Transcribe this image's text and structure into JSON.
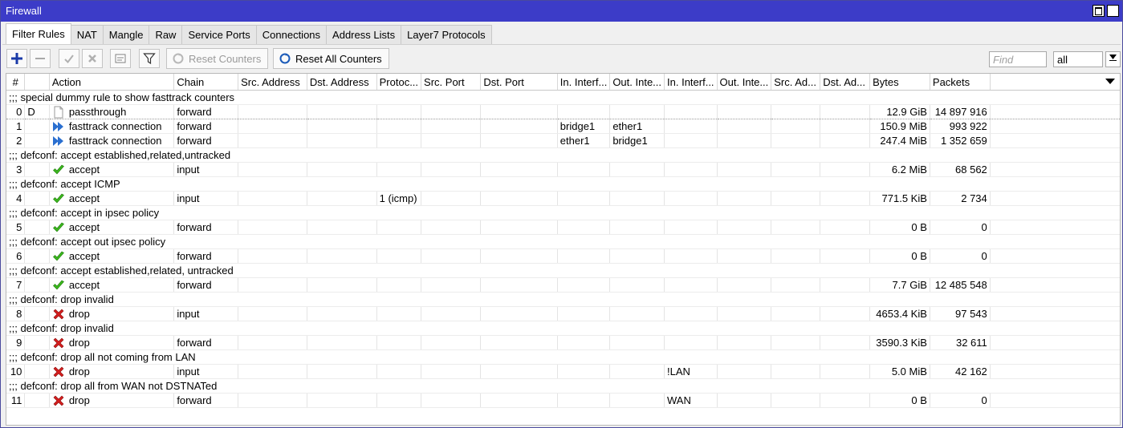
{
  "window": {
    "title": "Firewall"
  },
  "tabs": [
    {
      "label": "Filter Rules",
      "active": true
    },
    {
      "label": "NAT"
    },
    {
      "label": "Mangle"
    },
    {
      "label": "Raw"
    },
    {
      "label": "Service Ports"
    },
    {
      "label": "Connections"
    },
    {
      "label": "Address Lists"
    },
    {
      "label": "Layer7 Protocols"
    }
  ],
  "toolbar": {
    "add_icon": "plus-icon",
    "remove_icon": "minus-icon",
    "enable_icon": "check-icon",
    "disable_icon": "x-icon",
    "comment_icon": "note-icon",
    "filter_icon": "filter-icon",
    "reset_counters": "Reset Counters",
    "reset_all_counters": "Reset All Counters",
    "find_placeholder": "Find",
    "filter_select": "all"
  },
  "columns": [
    "#",
    "",
    "Action",
    "Chain",
    "Src. Address",
    "Dst. Address",
    "Protoc...",
    "Src. Port",
    "Dst. Port",
    "In. Interf...",
    "Out. Inte...",
    "In. Interf...",
    "Out. Inte...",
    "Src. Ad...",
    "Dst. Ad...",
    "Bytes",
    "Packets"
  ],
  "rows": [
    {
      "type": "comment",
      "text": ";;; special dummy rule to show fasttrack counters"
    },
    {
      "type": "rule",
      "num": "0",
      "flag": "D",
      "action": "passthrough",
      "icon": "passthrough",
      "chain": "forward",
      "proto": "",
      "in_if": "",
      "out_if": "",
      "in_list": "",
      "bytes": "12.9 GiB",
      "packets": "14 897 916"
    },
    {
      "type": "rule",
      "num": "1",
      "flag": "",
      "action": "fasttrack connection",
      "icon": "fasttrack",
      "chain": "forward",
      "proto": "",
      "in_if": "bridge1",
      "out_if": "ether1",
      "in_list": "",
      "bytes": "150.9 MiB",
      "packets": "993 922"
    },
    {
      "type": "rule",
      "num": "2",
      "flag": "",
      "action": "fasttrack connection",
      "icon": "fasttrack",
      "chain": "forward",
      "proto": "",
      "in_if": "ether1",
      "out_if": "bridge1",
      "in_list": "",
      "bytes": "247.4 MiB",
      "packets": "1 352 659"
    },
    {
      "type": "comment",
      "text": ";;; defconf: accept established,related,untracked"
    },
    {
      "type": "rule",
      "num": "3",
      "flag": "",
      "action": "accept",
      "icon": "accept",
      "chain": "input",
      "proto": "",
      "in_if": "",
      "out_if": "",
      "in_list": "",
      "bytes": "6.2 MiB",
      "packets": "68 562"
    },
    {
      "type": "comment",
      "text": ";;; defconf: accept ICMP"
    },
    {
      "type": "rule",
      "num": "4",
      "flag": "",
      "action": "accept",
      "icon": "accept",
      "chain": "input",
      "proto": "1 (icmp)",
      "in_if": "",
      "out_if": "",
      "in_list": "",
      "bytes": "771.5 KiB",
      "packets": "2 734"
    },
    {
      "type": "comment",
      "text": ";;; defconf: accept in ipsec policy"
    },
    {
      "type": "rule",
      "num": "5",
      "flag": "",
      "action": "accept",
      "icon": "accept",
      "chain": "forward",
      "proto": "",
      "in_if": "",
      "out_if": "",
      "in_list": "",
      "bytes": "0 B",
      "packets": "0"
    },
    {
      "type": "comment",
      "text": ";;; defconf: accept out ipsec policy"
    },
    {
      "type": "rule",
      "num": "6",
      "flag": "",
      "action": "accept",
      "icon": "accept",
      "chain": "forward",
      "proto": "",
      "in_if": "",
      "out_if": "",
      "in_list": "",
      "bytes": "0 B",
      "packets": "0"
    },
    {
      "type": "comment",
      "text": ";;; defconf: accept established,related, untracked"
    },
    {
      "type": "rule",
      "num": "7",
      "flag": "",
      "action": "accept",
      "icon": "accept",
      "chain": "forward",
      "proto": "",
      "in_if": "",
      "out_if": "",
      "in_list": "",
      "bytes": "7.7 GiB",
      "packets": "12 485 548"
    },
    {
      "type": "comment",
      "text": ";;; defconf: drop invalid"
    },
    {
      "type": "rule",
      "num": "8",
      "flag": "",
      "action": "drop",
      "icon": "drop",
      "chain": "input",
      "proto": "",
      "in_if": "",
      "out_if": "",
      "in_list": "",
      "bytes": "4653.4 KiB",
      "packets": "97 543"
    },
    {
      "type": "comment",
      "text": ";;; defconf: drop invalid"
    },
    {
      "type": "rule",
      "num": "9",
      "flag": "",
      "action": "drop",
      "icon": "drop",
      "chain": "forward",
      "proto": "",
      "in_if": "",
      "out_if": "",
      "in_list": "",
      "bytes": "3590.3 KiB",
      "packets": "32 611"
    },
    {
      "type": "comment",
      "text": ";;; defconf: drop all not coming from LAN"
    },
    {
      "type": "rule",
      "num": "10",
      "flag": "",
      "action": "drop",
      "icon": "drop",
      "chain": "input",
      "proto": "",
      "in_if": "",
      "out_if": "",
      "in_list": "!LAN",
      "bytes": "5.0 MiB",
      "packets": "42 162"
    },
    {
      "type": "comment",
      "text": ";;; defconf:  drop all from WAN not DSTNATed"
    },
    {
      "type": "rule",
      "num": "11",
      "flag": "",
      "action": "drop",
      "icon": "drop",
      "chain": "forward",
      "proto": "",
      "in_if": "",
      "out_if": "",
      "in_list": "WAN",
      "bytes": "0 B",
      "packets": "0"
    }
  ],
  "colors": {
    "titlebar": "#3c3cc8",
    "accept": "#3cb81e",
    "drop": "#d41e1e",
    "fasttrack": "#2a6fd0"
  }
}
